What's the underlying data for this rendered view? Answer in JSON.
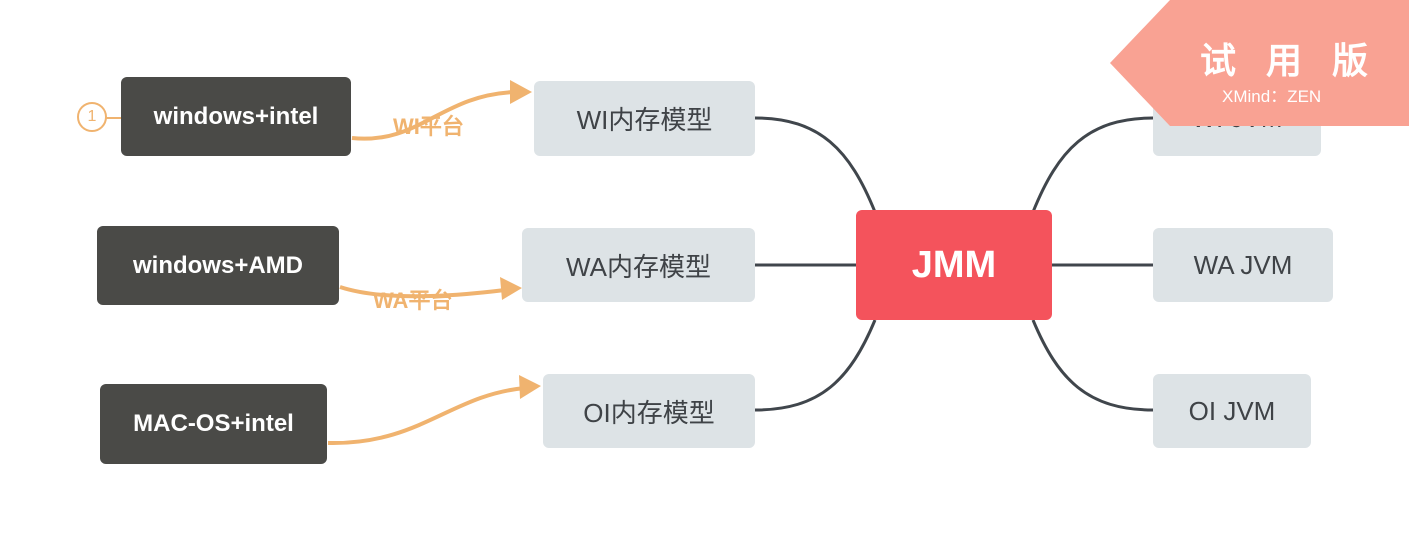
{
  "banner": {
    "title": "试 用 版",
    "subtitle": "XMind：ZEN"
  },
  "center": {
    "label": "JMM"
  },
  "memory_models": [
    {
      "label": "WI内存模型"
    },
    {
      "label": "WA内存模型"
    },
    {
      "label": "OI内存模型"
    }
  ],
  "jvms": [
    {
      "label": "WI JVM"
    },
    {
      "label": "WA JVM"
    },
    {
      "label": "OI JVM"
    }
  ],
  "platforms": [
    {
      "label": "windows+intel"
    },
    {
      "label": "windows+AMD"
    },
    {
      "label": "MAC-OS+intel"
    }
  ],
  "edge_labels": [
    "WI平台",
    "WA平台"
  ],
  "marker": {
    "label": "1"
  },
  "colors": {
    "center": "#f4535c",
    "dark_node": "#4a4a47",
    "light_node": "#dde3e6",
    "connector": "#40464c",
    "relation_arrow": "#f0b36f",
    "banner": "#f9a293"
  }
}
